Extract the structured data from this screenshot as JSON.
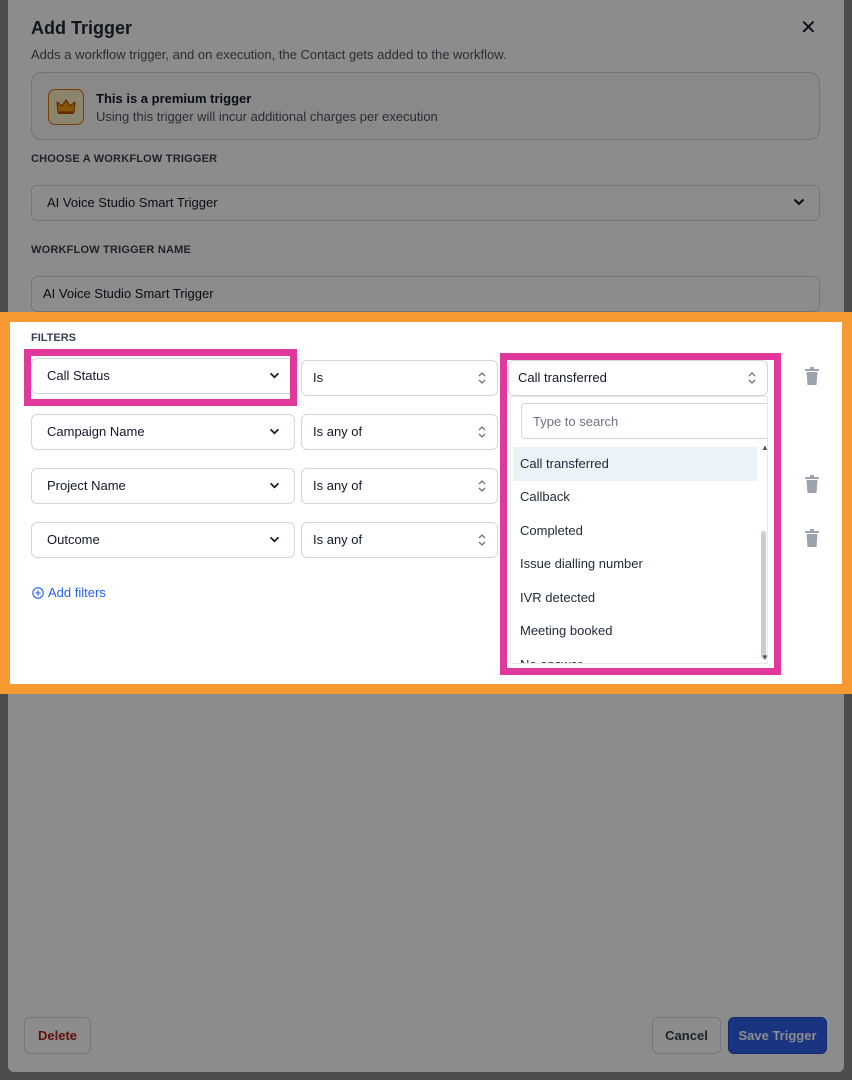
{
  "modal": {
    "title": "Add Trigger",
    "subtitle": "Adds a workflow trigger, and on execution, the Contact gets added to the workflow.",
    "close_icon": "close-icon"
  },
  "premium": {
    "icon": "crown-icon",
    "title": "This is a premium trigger",
    "description": "Using this trigger will incur additional charges per execution"
  },
  "choose_trigger": {
    "label": "CHOOSE A WORKFLOW TRIGGER",
    "value": "AI Voice Studio Smart Trigger"
  },
  "trigger_name": {
    "label": "WORKFLOW TRIGGER NAME",
    "value": "AI Voice Studio Smart Trigger"
  },
  "filters": {
    "label": "FILTERS",
    "rows": [
      {
        "field": "Call Status",
        "operator": "Is",
        "value": "Call transferred"
      },
      {
        "field": "Campaign Name",
        "operator": "Is any of"
      },
      {
        "field": "Project Name",
        "operator": "Is any of"
      },
      {
        "field": "Outcome",
        "operator": "Is any of"
      }
    ],
    "add_label": "Add filters"
  },
  "dropdown": {
    "search_placeholder": "Type to search",
    "options": [
      "Call transferred",
      "Callback",
      "Completed",
      "Issue dialling number",
      "IVR detected",
      "Meeting booked",
      "No answer"
    ],
    "selected": "Call transferred"
  },
  "footer": {
    "delete_label": "Delete",
    "cancel_label": "Cancel",
    "save_label": "Save Trigger"
  },
  "colors": {
    "highlight_orange": "#f79a32",
    "highlight_pink": "#e0399b",
    "primary": "#2f5fec",
    "danger": "#b91c1c"
  }
}
